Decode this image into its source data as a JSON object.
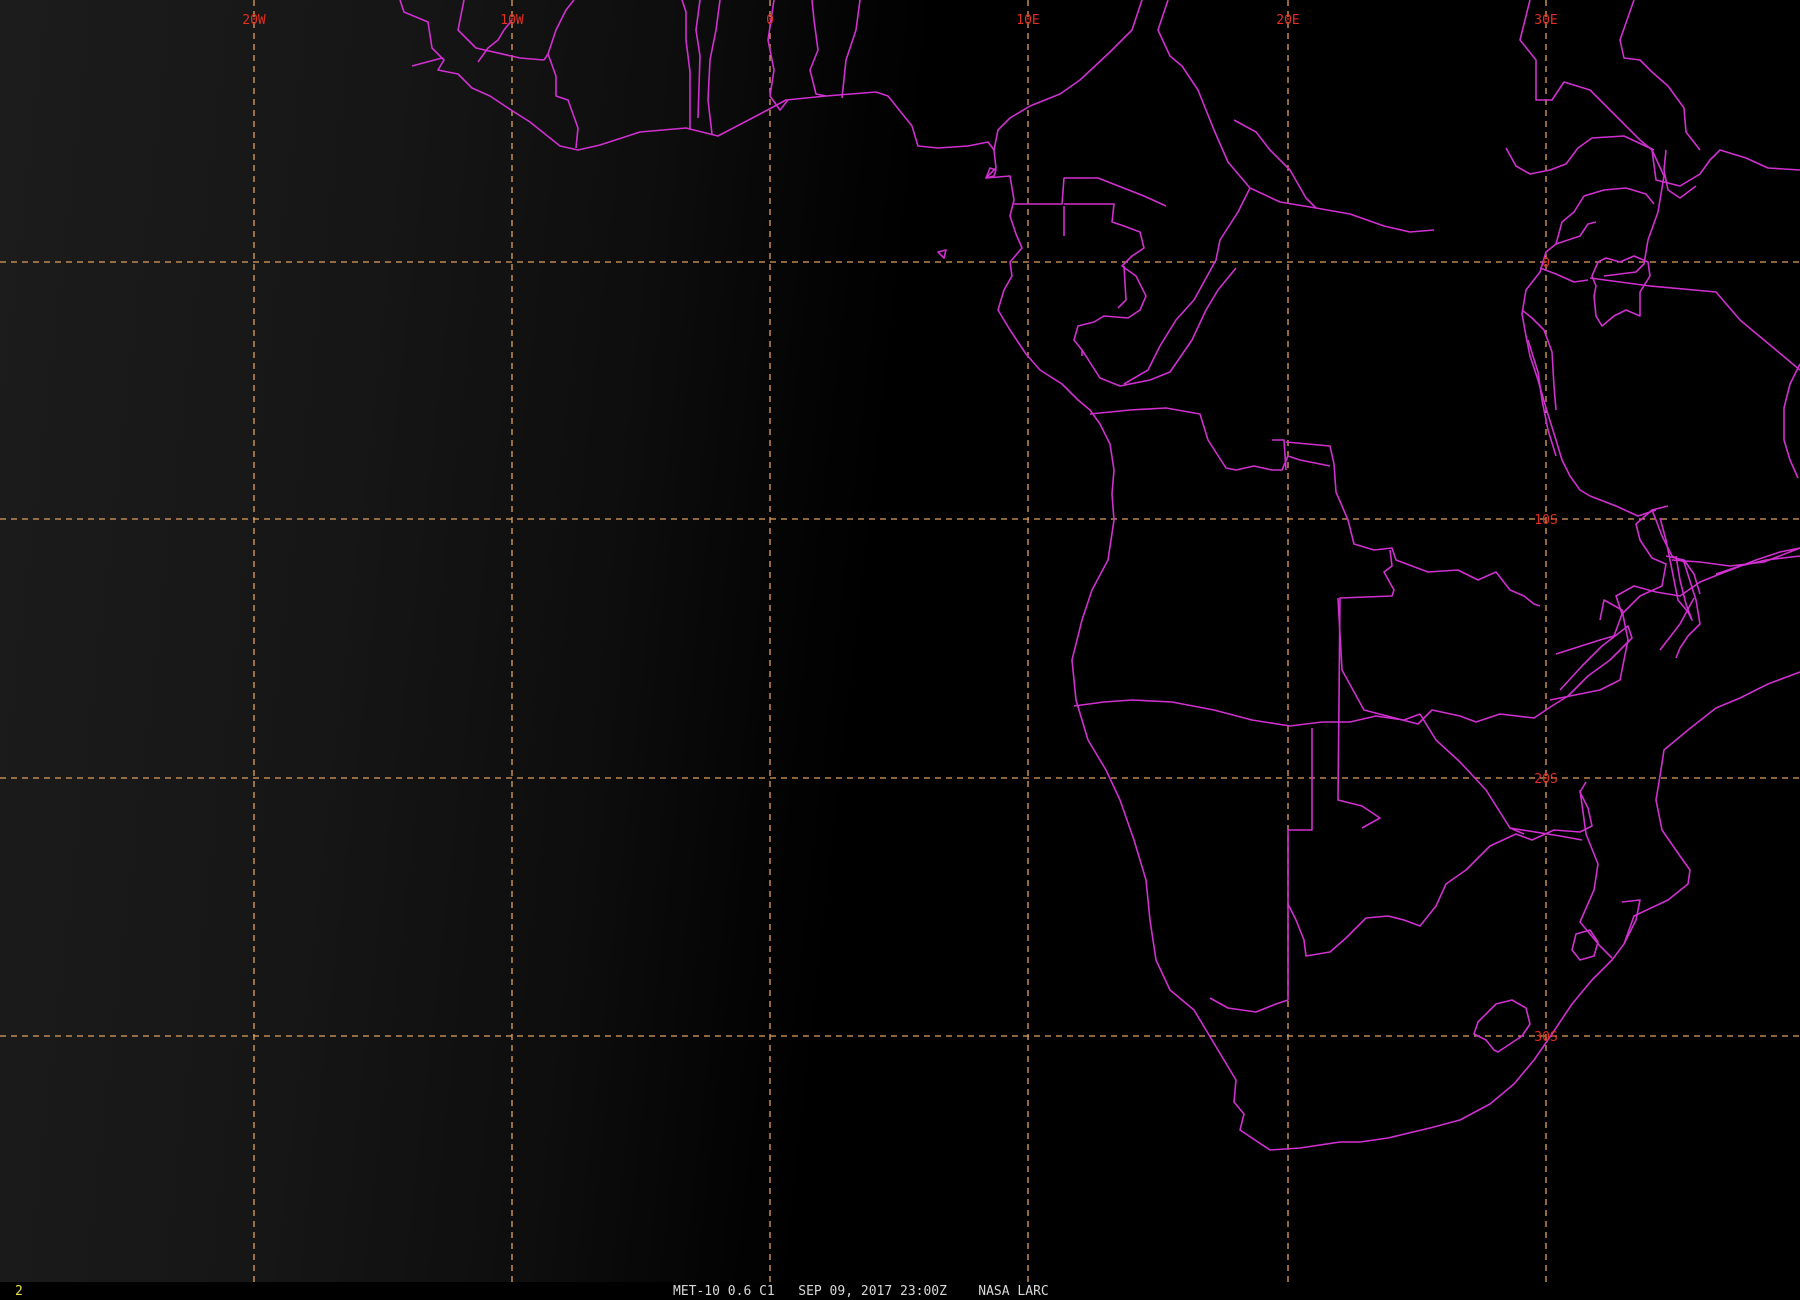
{
  "colors": {
    "background": "#000000",
    "grid": "#e0a060",
    "grid_label": "#e03020",
    "borders": "#d030d0",
    "footer_text": "#d8d8d8",
    "frame_number": "#e8e040"
  },
  "grid": {
    "longitude_labels": [
      "20W",
      "10W",
      "0",
      "10E",
      "20E",
      "30E"
    ],
    "latitude_labels": [
      "0",
      "10S",
      "20S",
      "30S"
    ]
  },
  "footer": {
    "frame_number": "2",
    "satellite": "MET-10",
    "channel": "0.6 C1",
    "datetime": "SEP 09, 2017 23:00Z",
    "source": "NASA LARC"
  },
  "map": {
    "projection_note": "",
    "layers": [
      "political-borders-icon",
      "lat-lon-grid"
    ]
  }
}
